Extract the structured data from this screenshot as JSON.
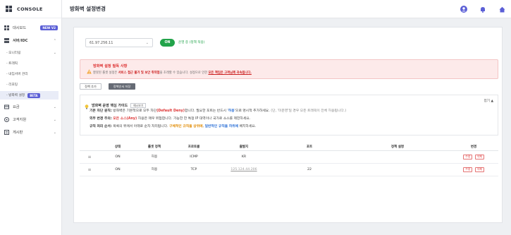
{
  "app": {
    "brand": "CONSOLE"
  },
  "sidebar": {
    "dashboard": {
      "label": "대시보드",
      "badge": "NEW V2"
    },
    "server": {
      "label": "서버/IDC"
    },
    "sub": {
      "monitoring": "- 모니터링",
      "traffic": "- 트래픽",
      "internal": "- 내임서버 관리",
      "report": "- 리포팅",
      "firewall": "- 방화벽 설정",
      "firewall_badge": "BETA"
    },
    "billing": {
      "label": "요금"
    },
    "support": {
      "label": "고객지원"
    },
    "board": {
      "label": "게시판"
    }
  },
  "header": {
    "title": "방화벽 설정변경"
  },
  "server_select": {
    "value": "61.97.256.11"
  },
  "toggle": {
    "label": "ON",
    "status": "운영 중 (정책 적용)"
  },
  "alert": {
    "title": "방화벽 설정 필독 사항",
    "d1": "잘못된 룰셋 설정은 ",
    "d2": "서비스 접근 불가 및 보안 취약점",
    "d3": "을 초래할 수 있습니다. 설정으로 인한 ",
    "d4": "모든 책임은 고객님께 귀속됩니다."
  },
  "buttons": {
    "add": "정책 추가",
    "save_order": "정책순서 저장"
  },
  "guide": {
    "title": "방화벽 운영 핵심 가이드",
    "tag": "예시보기",
    "fold": "접기 ▲",
    "l1": {
      "head": "기본 차단 원칙:",
      "a": " 방화벽은 기본적으로 모두 차단",
      "b": "(Default Deny)",
      "c": "합니다. 필요한 포트는 반드시 '",
      "d": "허용",
      "e": "'으로 명시적 추가하세요. ",
      "f": "(단, '미운영'일 경우 모든 트래픽이 전체 허용됩니다.)"
    },
    "l2": {
      "head": "외부 변경 주의:",
      "a": " ",
      "b": "모든 소스(Any)",
      "c": " 허용은 매우 위험합니다. 가능한 한 특정 IP 대역이나 국가로 소스를 제한하세요."
    },
    "l3": {
      "head": "규칙 처리 순서:",
      "a": " 목록의 위에서 아래로 순차 처리됩니다. ",
      "b": "구체적인 규칙을 상위에",
      "c": ", ",
      "d": "일반적인 규칙을 하위에",
      "e": " 배치하세요."
    }
  },
  "table": {
    "headers": {
      "status": "상태",
      "rule": "룰셋 정책",
      "protocol": "프로토콜",
      "source": "출발지",
      "port": "포트",
      "policy": "정책 설명",
      "change": "변경"
    },
    "rows": [
      {
        "status": "ON",
        "rule": "허용",
        "protocol": "ICMP",
        "source": "KR",
        "port": "",
        "policy": "",
        "edit": "수정",
        "delete": "삭제"
      },
      {
        "status": "ON",
        "rule": "허용",
        "protocol": "TCP",
        "source": "125.124.44.206",
        "port": "22",
        "policy": "",
        "edit": "수정",
        "delete": "삭제"
      }
    ]
  },
  "colors": {
    "accent": "#5b5fd6",
    "on": "#22a34a",
    "danger": "#d33333"
  }
}
